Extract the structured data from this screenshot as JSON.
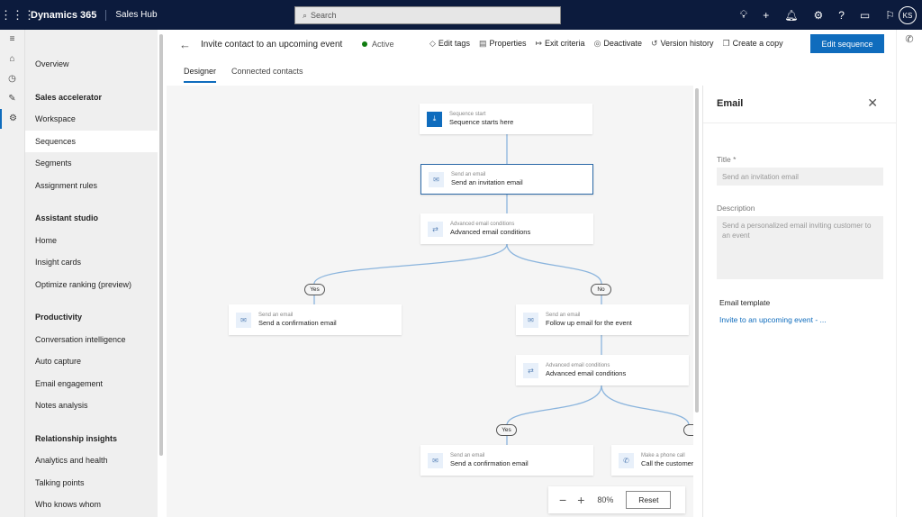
{
  "topbar": {
    "brand": "Dynamics 365",
    "app": "Sales Hub",
    "search_placeholder": "Search",
    "user_initials": "KS"
  },
  "sidebar": {
    "items": [
      {
        "type": "item",
        "label": "Overview"
      },
      {
        "type": "header",
        "label": "Sales accelerator"
      },
      {
        "type": "item",
        "label": "Workspace"
      },
      {
        "type": "item",
        "label": "Sequences",
        "selected": true
      },
      {
        "type": "item",
        "label": "Segments"
      },
      {
        "type": "item",
        "label": "Assignment rules"
      },
      {
        "type": "header",
        "label": "Assistant studio"
      },
      {
        "type": "item",
        "label": "Home"
      },
      {
        "type": "item",
        "label": "Insight cards"
      },
      {
        "type": "item",
        "label": "Optimize ranking (preview)"
      },
      {
        "type": "header",
        "label": "Productivity"
      },
      {
        "type": "item",
        "label": "Conversation intelligence"
      },
      {
        "type": "item",
        "label": "Auto capture"
      },
      {
        "type": "item",
        "label": "Email engagement"
      },
      {
        "type": "item",
        "label": "Notes analysis"
      },
      {
        "type": "header",
        "label": "Relationship insights"
      },
      {
        "type": "item",
        "label": "Analytics and health"
      },
      {
        "type": "item",
        "label": "Talking points"
      },
      {
        "type": "item",
        "label": "Who knows whom"
      }
    ]
  },
  "header": {
    "title": "Invite contact to an upcoming event",
    "status": "Active",
    "actions": [
      "Edit tags",
      "Properties",
      "Exit criteria",
      "Deactivate",
      "Version history",
      "Create a copy"
    ],
    "primary": "Edit sequence",
    "tabs": [
      "Designer",
      "Connected contacts"
    ]
  },
  "canvas": {
    "nodes": [
      {
        "sub": "Sequence start",
        "main": "Sequence starts here"
      },
      {
        "sub": "Send an email",
        "main": "Send an invitation email"
      },
      {
        "sub": "Advanced email conditions",
        "main": "Advanced email conditions"
      },
      {
        "sub": "Send an email",
        "main": "Send a confirmation email"
      },
      {
        "sub": "Send an email",
        "main": "Follow up email for the event"
      },
      {
        "sub": "Advanced email conditions",
        "main": "Advanced email conditions"
      },
      {
        "sub": "Send an email",
        "main": "Send a confirmation email"
      },
      {
        "sub": "Make a phone call",
        "main": "Call the customer t"
      }
    ],
    "branches": {
      "yes": "Yes",
      "no": "No"
    },
    "zoom": "80%",
    "reset": "Reset"
  },
  "panel": {
    "title": "Email",
    "title_label": "Title *",
    "title_placeholder": "Send an invitation email",
    "description_label": "Description",
    "description_placeholder": "Send a personalized email inviting customer to an event",
    "template_label": "Email template",
    "template_link": "Invite to an upcoming event - ..."
  }
}
